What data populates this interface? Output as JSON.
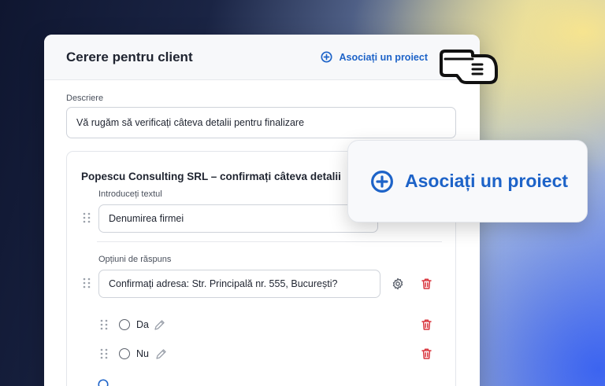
{
  "card": {
    "title": "Cerere pentru client",
    "associate_link": "Asociați un proiect"
  },
  "description": {
    "label": "Descriere",
    "value": "Vă rugăm să verificați câteva detalii pentru finalizare"
  },
  "section": {
    "title": "Popescu Consulting SRL – confirmați câteva detalii",
    "text_field_label": "Introduceți textul",
    "text_field_value": "Denumirea firmei",
    "options_label": "Opțiuni de răspuns",
    "question_value": "Confirmați adresa: Str. Principală nr. 555, București?",
    "options": [
      {
        "label": "Da"
      },
      {
        "label": "Nu"
      }
    ]
  },
  "popup": {
    "label": "Asociați un proiect"
  },
  "colors": {
    "accent": "#1d63c8",
    "danger": "#d9363e"
  }
}
